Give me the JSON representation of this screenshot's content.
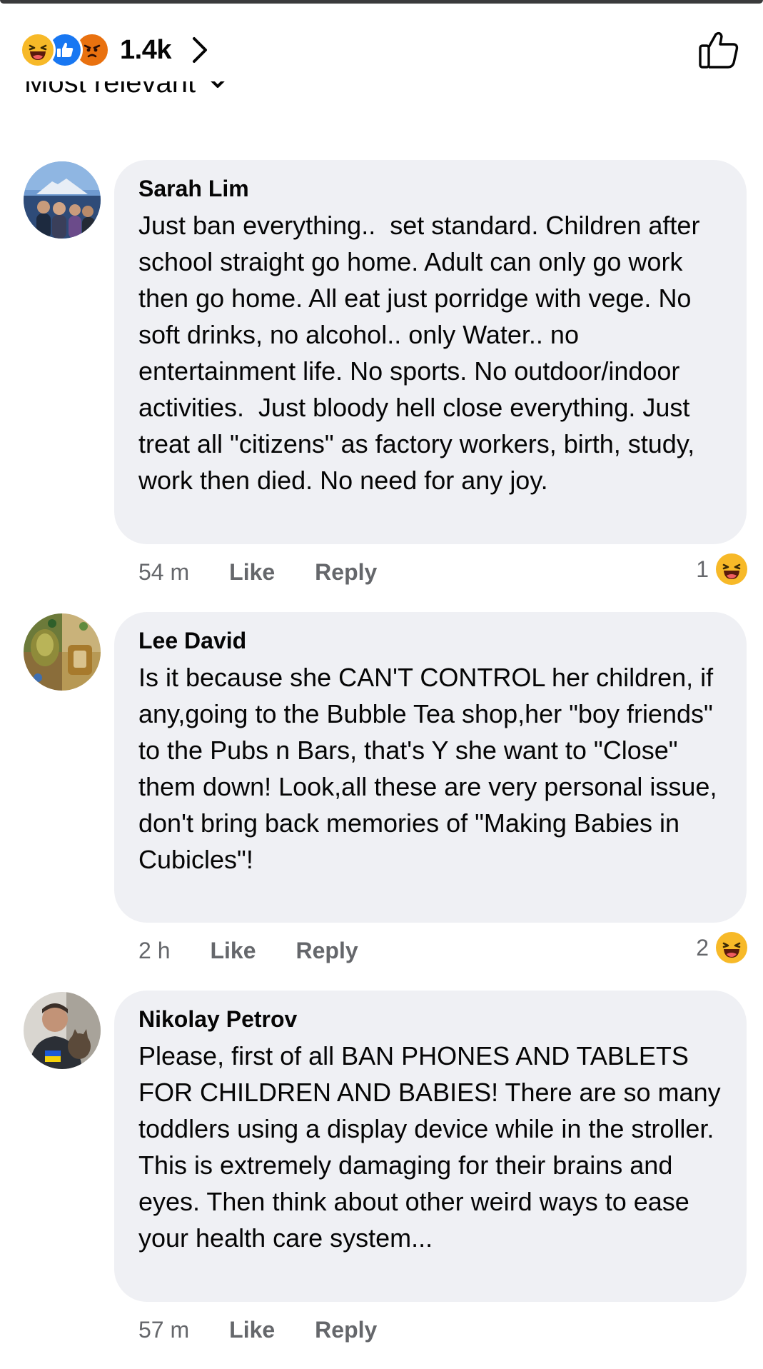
{
  "header": {
    "reaction_count": "1.4k",
    "reaction_icons": [
      "haha-icon",
      "like-icon",
      "angry-icon"
    ],
    "sort_label": "Most relevant"
  },
  "colors": {
    "bubble_bg": "#eff0f4",
    "meta_text": "#65676b",
    "like_blue": "#1877f2",
    "haha_yellow": "#f7b928",
    "angry_orange": "#e9710f"
  },
  "comments": [
    {
      "author": "Sarah Lim",
      "text": "Just ban everything..  set standard. Children after school straight go home. Adult can only go work then go home. All eat just porridge with vege. No soft drinks, no alcohol.. only Water.. no entertainment life. No sports. No outdoor/indoor activities.  Just bloody hell close everything. Just treat all \"citizens\" as factory workers, birth, study, work then died. No need for any joy.",
      "time": "54 m",
      "like_label": "Like",
      "reply_label": "Reply",
      "reaction_count": "1",
      "reaction_icon": "haha-icon"
    },
    {
      "author": "Lee David",
      "text": "Is it because she CAN'T CONTROL her children, if any,going to the Bubble Tea shop,her \"boy friends\" to the Pubs n Bars, that's Y she want to \"Close\" them down! Look,all these are very personal issue, don't bring back memories of \"Making Babies in Cubicles\"!",
      "time": "2 h",
      "like_label": "Like",
      "reply_label": "Reply",
      "reaction_count": "2",
      "reaction_icon": "haha-icon"
    },
    {
      "author": "Nikolay Petrov",
      "text": "Please, first of all BAN PHONES AND TABLETS FOR CHILDREN AND BABIES! There are so many toddlers using a display device while in the stroller. This is extremely damaging for their brains and eyes. Then think about other weird ways to ease your health care system...",
      "time": "57 m",
      "like_label": "Like",
      "reply_label": "Reply"
    }
  ]
}
